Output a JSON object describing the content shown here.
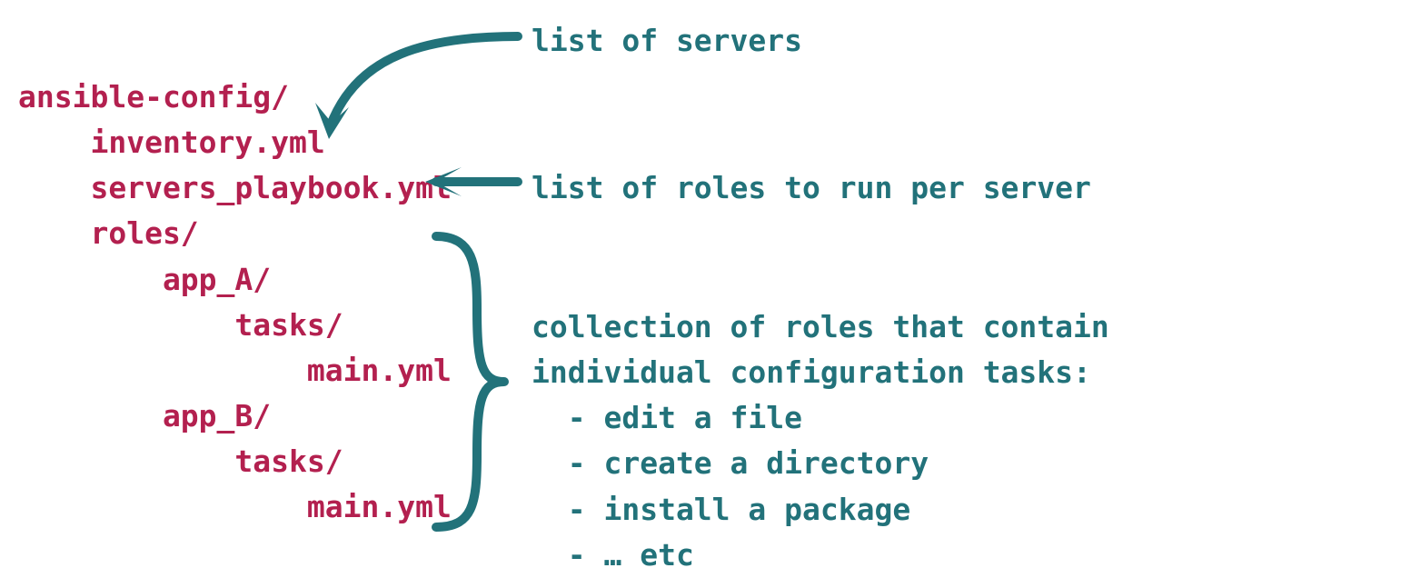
{
  "colors": {
    "tree": "#b3204f",
    "annot": "#22727a"
  },
  "tree": {
    "lines": [
      {
        "indent": 0,
        "text": "ansible-config/"
      },
      {
        "indent": 1,
        "text": "inventory.yml"
      },
      {
        "indent": 1,
        "text": "servers_playbook.yml"
      },
      {
        "indent": 1,
        "text": "roles/"
      },
      {
        "indent": 2,
        "text": "app_A/"
      },
      {
        "indent": 3,
        "text": "tasks/"
      },
      {
        "indent": 4,
        "text": "main.yml"
      },
      {
        "indent": 2,
        "text": "app_B/"
      },
      {
        "indent": 3,
        "text": "tasks/"
      },
      {
        "indent": 4,
        "text": "main.yml"
      }
    ]
  },
  "annotations": {
    "a1": "list of servers",
    "a2": "list of roles to run per server",
    "a3_line1": "collection of roles that contain",
    "a3_line2": "individual configuration tasks:",
    "a3_items": [
      "- edit a file",
      "- create a directory",
      "- install a package",
      "- … etc"
    ]
  }
}
